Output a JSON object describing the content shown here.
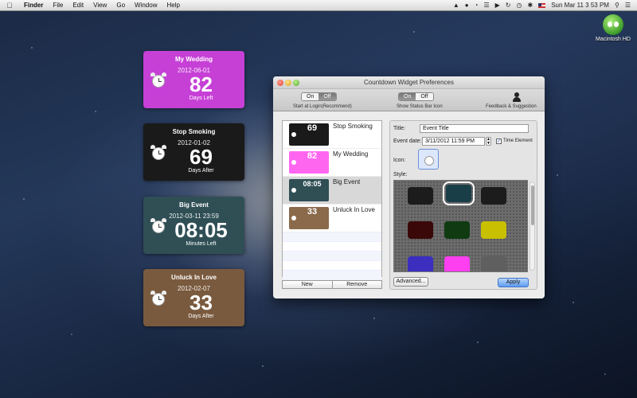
{
  "menubar": {
    "apple_icon": "apple-logo-icon",
    "items": [
      "Finder",
      "File",
      "Edit",
      "View",
      "Go",
      "Window",
      "Help"
    ],
    "clock": "Sun Mar 11  3 53 PM"
  },
  "desktop": {
    "drive_label": "Macintosh HD"
  },
  "widgets": [
    {
      "title": "My Wedding",
      "date": "2012-06-01",
      "count": "82",
      "unit": "Days Left",
      "color": "#c640d6"
    },
    {
      "title": "Stop Smoking",
      "date": "2012-01-02",
      "count": "69",
      "unit": "Days After",
      "color": "#1a1a1a"
    },
    {
      "title": "Big Event",
      "date": "2012-03-11 23:59",
      "count": "08:05",
      "unit": "Minutes Left",
      "color": "#2f4f55"
    },
    {
      "title": "Unluck In Love",
      "date": "2012-02-07",
      "count": "33",
      "unit": "Days After",
      "color": "#7a5a3e"
    }
  ],
  "window": {
    "title": "Countdown Widget Preferences",
    "toolbar": {
      "login_on": "On",
      "login_off": "Off",
      "login_label": "Start at Login(Recommend)",
      "status_on": "On",
      "status_off": "Off",
      "status_label": "Show Status Bar Icon",
      "feedback_label": "Feedback & Suggestion"
    },
    "events": [
      {
        "name": "Stop Smoking",
        "num": "69",
        "color": "#1a1a1a"
      },
      {
        "name": "My Wedding",
        "num": "82",
        "color": "#ff66f0"
      },
      {
        "name": "Big Event",
        "num": "08:05",
        "color": "#2f4f55"
      },
      {
        "name": "Unluck In Love",
        "num": "33",
        "color": "#8a6a4a"
      }
    ],
    "new_button": "New",
    "remove_button": "Remove",
    "form": {
      "title_label": "Title:",
      "title_value": "Event Title",
      "date_label": "Event date:",
      "date_value": "3/11/2012 11:59 PM",
      "time_element_label": "Time Element",
      "time_element_checked": true,
      "icon_label": "Icon:",
      "style_label": "Style:"
    },
    "style_colors": [
      "#1c1c1c",
      "#193e48",
      "#1c1c1c",
      "#3a0808",
      "#0f3a12",
      "#c8c000",
      "#3c2fc0",
      "#ff3ff0",
      "#5f5f5f"
    ],
    "advanced_button": "Advanced...",
    "apply_button": "Apply"
  }
}
